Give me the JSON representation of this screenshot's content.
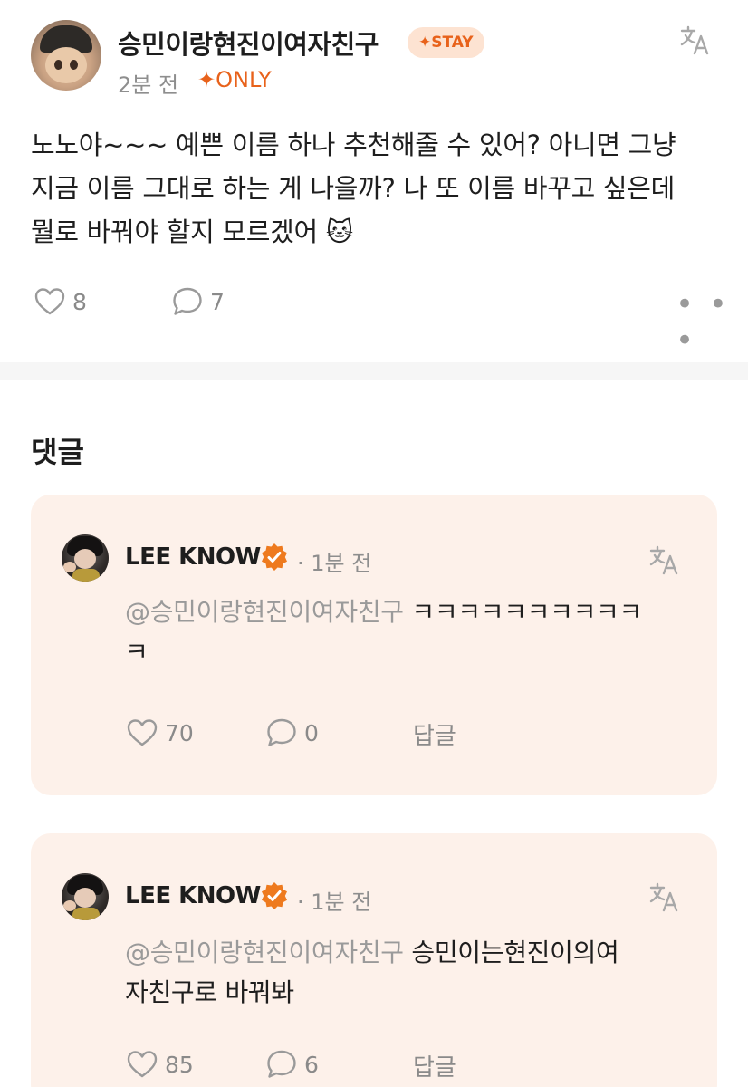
{
  "post": {
    "author": "승민이랑현진이여자친구",
    "badge": "✦STAY",
    "time": "2분 전",
    "only_label": "✦ONLY",
    "body_line1": "노노야~~~ 예쁜 이름 하나 추천해줄 수 있어? 아니면 그냥",
    "body_line2": "지금 이름 그대로 하는 게 나을까? 나 또 이름 바꾸고 싶은데",
    "body_line3": "뭘로 바꿔야 할지 모르겠어 🐱",
    "likes": "8",
    "comments": "7",
    "more": "• • •"
  },
  "comments_section": {
    "title": "댓글",
    "items": [
      {
        "name": "LEE KNOW",
        "time": "· 1분 전",
        "mention": "@승민이랑현진이여자친구",
        "text_line1": "ㅋㅋㅋㅋㅋㅋㅋㅋㅋㅋ",
        "text_line2": "ㅋ",
        "likes": "70",
        "comments": "0",
        "reply": "답글"
      },
      {
        "name": "LEE KNOW",
        "time": "· 1분 전",
        "mention": "@승민이랑현진이여자친구",
        "text_line1": "승민이는현진이의여",
        "text_line2": "자친구로 바꿔봐",
        "likes": "85",
        "comments": "6",
        "reply": "답글"
      }
    ]
  },
  "colors": {
    "accent": "#e8621b",
    "card_bg": "#fdf1ea",
    "muted": "#8e8e8e"
  },
  "icons": [
    "translate-icon",
    "heart-icon",
    "comment-icon",
    "more-icon",
    "verified-icon"
  ]
}
